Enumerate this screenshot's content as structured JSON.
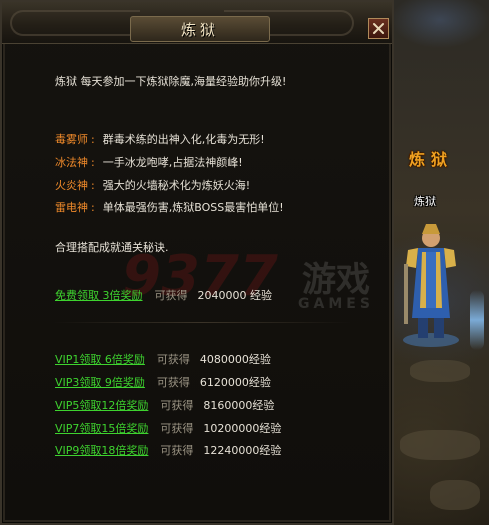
{
  "dialog": {
    "title": "炼狱",
    "close_label": "X"
  },
  "intro": "炼狱 每天参加一下炼狱除魔,海量经验助你升级!",
  "roles": [
    {
      "name": "毒雾师",
      "sep": ":",
      "desc": "群毒术练的出神入化,化毒为无形!"
    },
    {
      "name": "冰法神",
      "sep": ":",
      "desc": "一手冰龙咆哮,占据法神颜峰!"
    },
    {
      "name": "火炎神",
      "sep": ":",
      "desc": "强大的火墙秘术化为炼妖火海!"
    },
    {
      "name": "雷电神",
      "sep": ":",
      "desc": "单体最强伤害,炼狱BOSS最害怕单位!"
    }
  ],
  "tip": "合理搭配成就通关秘诀.",
  "free_reward": {
    "link": "免费领取 3倍奖励",
    "get": "可获得",
    "amount": "2040000 经验"
  },
  "vip_rewards": [
    {
      "link": "VIP1领取 6倍奖励",
      "get": "可获得",
      "amount": "4080000经验"
    },
    {
      "link": "VIP3领取 9倍奖励",
      "get": "可获得",
      "amount": "6120000经验"
    },
    {
      "link": "VIP5领取12倍奖励",
      "get": "可获得",
      "amount": "8160000经验"
    },
    {
      "link": "VIP7领取15倍奖励",
      "get": "可获得",
      "amount": "10200000经验"
    },
    {
      "link": "VIP9领取18倍奖励",
      "get": "可获得",
      "amount": "12240000经验"
    }
  ],
  "npc": {
    "banner": "炼狱",
    "name": "炼狱"
  },
  "watermark": {
    "number": "9377",
    "cn": "游戏",
    "en": "GAMES"
  },
  "colors": {
    "role_name": "#f08a2a",
    "reward_link": "#3ed32f",
    "muted": "#9b9484",
    "text": "#e6e1d6",
    "banner": "#f0a020"
  }
}
